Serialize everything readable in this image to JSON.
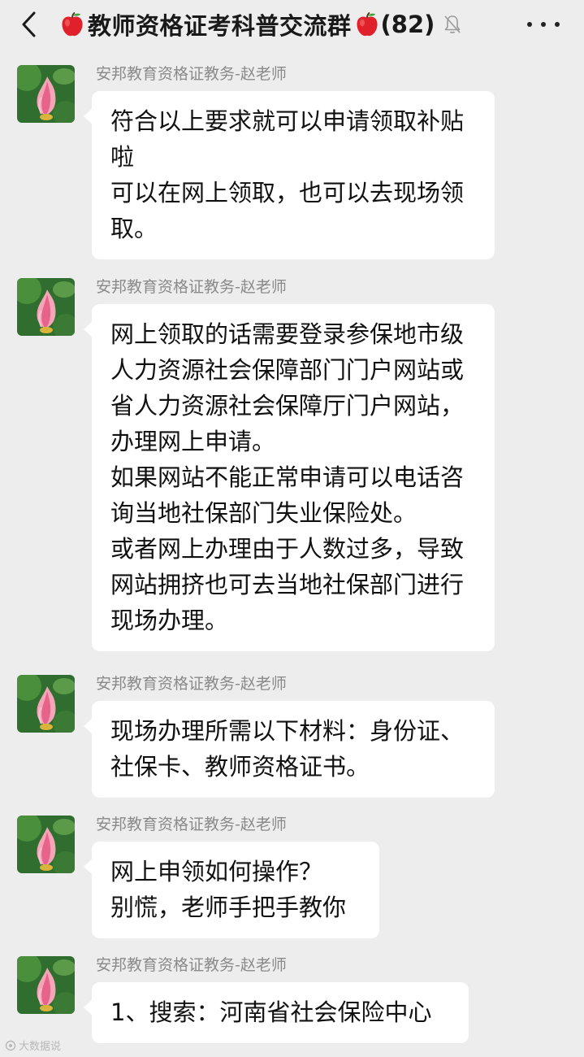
{
  "header": {
    "title": "教师资格证考科普交流群",
    "member_count": "(82)",
    "back_icon": "chevron-left-icon",
    "mute_icon": "bell-off-icon",
    "more_icon": "more-dots-icon",
    "apple_icon": "apple-emoji"
  },
  "messages": [
    {
      "sender": "安邦教育资格证教务-赵老师",
      "text": "符合以上要求就可以申请领取补贴啦\n可以在网上领取，也可以去现场领取。"
    },
    {
      "sender": "安邦教育资格证教务-赵老师",
      "text": "网上领取的话需要登录参保地市级人力资源社会保障部门门户网站或省人力资源社会保障厅门户网站，办理网上申请。\n如果网站不能正常申请可以电话咨询当地社保部门失业保险处。\n或者网上办理由于人数过多，导致网站拥挤也可去当地社保部门进行现场办理。"
    },
    {
      "sender": "安邦教育资格证教务-赵老师",
      "text": "现场办理所需以下材料：身份证、社保卡、教师资格证书。"
    },
    {
      "sender": "安邦教育资格证教务-赵老师",
      "text": "网上申领如何操作？\n别慌，老师手把手教你"
    },
    {
      "sender": "安邦教育资格证教务-赵老师",
      "text": "1、搜索：河南省社会保险中心"
    }
  ],
  "watermark": {
    "text": "大数据说"
  },
  "colors": {
    "background": "#ededed",
    "bubble": "#ffffff",
    "sender_text": "#8a8a8a",
    "title_text": "#191919"
  }
}
